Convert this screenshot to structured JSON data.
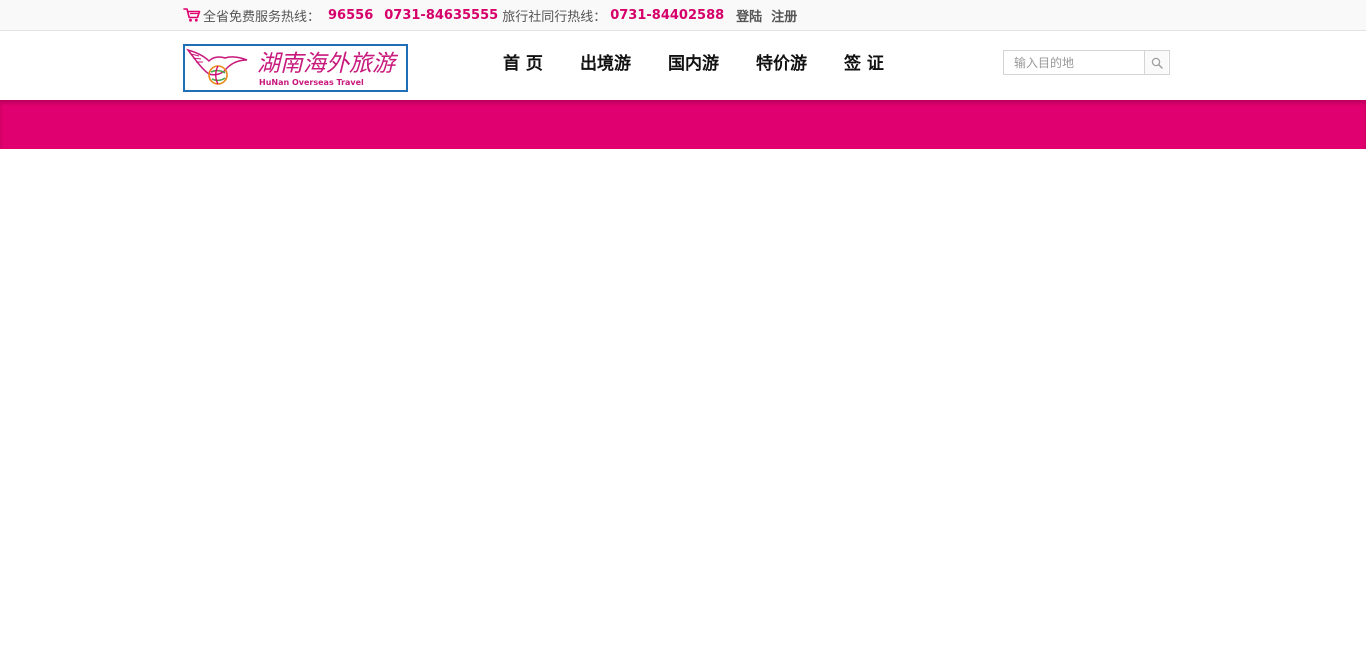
{
  "topbar": {
    "cart_icon": "shopping-cart-icon",
    "hotline_label": "全省免费服务热线：",
    "hotline_1": "96556",
    "hotline_2": "0731-84635555",
    "agency_label": "旅行社同行热线：",
    "agency_number": "0731-84402588",
    "login": "登陆",
    "register": "注册"
  },
  "logo": {
    "text_cn": "湖南海外旅游",
    "text_en": "HuNan  Overseas Travel"
  },
  "nav": {
    "items": [
      {
        "label": "首 页"
      },
      {
        "label": "出境游"
      },
      {
        "label": "国内游"
      },
      {
        "label": "特价游"
      },
      {
        "label": "签 证"
      }
    ]
  },
  "search": {
    "placeholder": "输入目的地",
    "icon": "search-icon"
  },
  "colors": {
    "accent": "#e0006f",
    "hotline": "#d6006b",
    "logo_border": "#1f6fb7"
  }
}
